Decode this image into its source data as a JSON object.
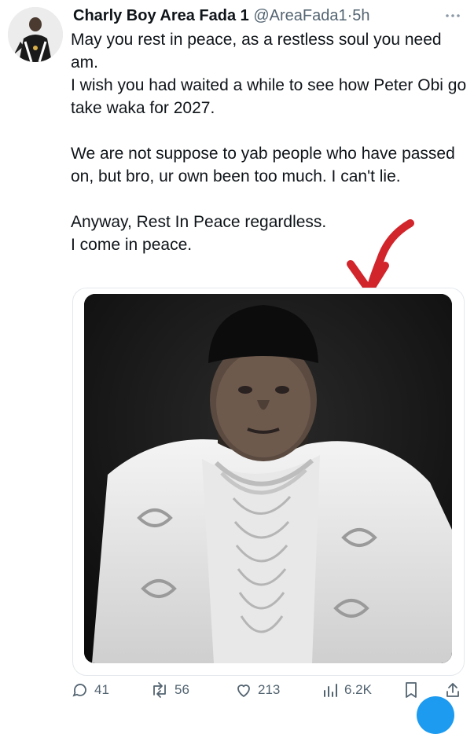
{
  "tweet": {
    "author_name": "Charly Boy Area Fada 1",
    "author_handle": "@AreaFada1",
    "separator": "·",
    "time": "5h",
    "paragraphs": [
      [
        "May you rest in peace, as a restless soul you need am.",
        "I wish you had waited a while to see how Peter Obi go take waka for 2027."
      ],
      [
        "We are not suppose to yab people who have passed on, but bro, ur own been too much. I can't lie."
      ],
      [
        "Anyway, Rest In Peace regardless.",
        "I come in peace."
      ]
    ]
  },
  "actions": {
    "replies": "41",
    "reposts": "56",
    "likes": "213",
    "views": "6.2K"
  },
  "icons": {
    "reply": "reply-icon",
    "repost": "repost-icon",
    "like": "heart-icon",
    "views": "views-icon",
    "bookmark": "bookmark-icon",
    "share": "share-icon",
    "more": "more-icon",
    "arrow": "red-arrow-annotation"
  },
  "colors": {
    "text": "#0f1419",
    "muted": "#536471",
    "accent": "#1d9bf0",
    "annotation": "#d1242b"
  }
}
